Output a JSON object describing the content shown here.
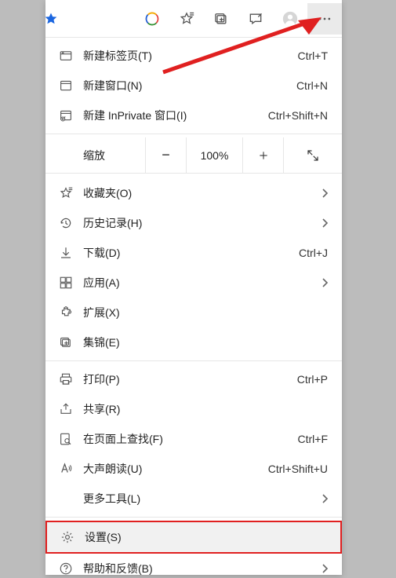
{
  "menu": {
    "new_tab": {
      "label": "新建标签页(T)",
      "shortcut": "Ctrl+T"
    },
    "new_window": {
      "label": "新建窗口(N)",
      "shortcut": "Ctrl+N"
    },
    "new_inprivate": {
      "label": "新建 InPrivate 窗口(I)",
      "shortcut": "Ctrl+Shift+N"
    },
    "zoom": {
      "label": "缩放",
      "value": "100%",
      "minus": "−",
      "plus": "+"
    },
    "favorites": {
      "label": "收藏夹(O)"
    },
    "history": {
      "label": "历史记录(H)"
    },
    "downloads": {
      "label": "下载(D)",
      "shortcut": "Ctrl+J"
    },
    "apps": {
      "label": "应用(A)"
    },
    "extensions": {
      "label": "扩展(X)"
    },
    "collections": {
      "label": "集锦(E)"
    },
    "print": {
      "label": "打印(P)",
      "shortcut": "Ctrl+P"
    },
    "share": {
      "label": "共享(R)"
    },
    "find": {
      "label": "在页面上查找(F)",
      "shortcut": "Ctrl+F"
    },
    "read_aloud": {
      "label": "大声朗读(U)",
      "shortcut": "Ctrl+Shift+U"
    },
    "more_tools": {
      "label": "更多工具(L)"
    },
    "settings": {
      "label": "设置(S)"
    },
    "help": {
      "label": "帮助和反馈(B)"
    }
  }
}
